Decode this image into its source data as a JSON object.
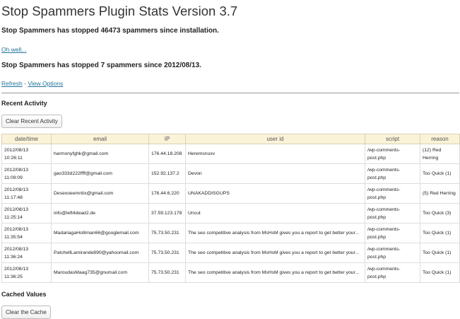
{
  "header": {
    "title": "Stop Spammers Plugin Stats Version 3.7"
  },
  "stats": {
    "total_line": "Stop Spammers has stopped 46473 spammers since installation.",
    "ohwell_label": "Oh well...",
    "since_line": "Stop Spammers has stopped 7 spammers since 2012/08/13."
  },
  "links": {
    "refresh_label": "Refresh",
    "separator": " - ",
    "options_label": "View Options"
  },
  "recent": {
    "heading": "Recent Activity",
    "clear_button": "Clear Recent Activity",
    "columns": [
      "date/time",
      "email",
      "IP",
      "user id",
      "script",
      "reason"
    ],
    "rows": [
      {
        "date": "2012/08/13",
        "time": "10:26:11",
        "email": "harmonyfghk@gmail.com",
        "ip": "176.44.18.208",
        "user": "Heremsnuxv",
        "script": "/wp-comments-post.php",
        "reason": "(12) Red Herring"
      },
      {
        "date": "2012/08/13",
        "time": "11:09:09",
        "email": "gao333d222ffff@gmail.com",
        "ip": "152.92.137.2",
        "user": "Devon",
        "script": "/wp-comments-post.php",
        "reason": "Too Quick (1)"
      },
      {
        "date": "2012/08/13",
        "time": "11:17:48",
        "email": "Desexoeemnlix@gmail.com",
        "ip": "176.44.6.220",
        "user": "UNAKADDISGUPS",
        "script": "/wp-comments-post.php",
        "reason": "(5) Red Herring"
      },
      {
        "date": "2012/08/13",
        "time": "11:25:14",
        "email": "info@left4dead2.de",
        "ip": "37.59.123.178",
        "user": "Uncut",
        "script": "/wp-comments-post.php",
        "reason": "Too Quick (3)"
      },
      {
        "date": "2012/08/13",
        "time": "11:35:54",
        "email": "MadariagaHolliman66@googlemail.com",
        "ip": "75.73.50.231",
        "user": "The seo competitive analysis from MsHsM gives you a report to get better your...",
        "script": "/wp-comments-post.php",
        "reason": "Too Quick (1)"
      },
      {
        "date": "2012/08/13",
        "time": "11:36:24",
        "email": "PatchellLamirande890@yahoomail.com",
        "ip": "75.73.50.231",
        "user": "The seo competitive analysis from MsHsM gives you a report to get better your...",
        "script": "/wp-comments-post.php",
        "reason": "Too Quick (1)"
      },
      {
        "date": "2012/08/13",
        "time": "11:36:25",
        "email": "MaroudasMaag735@gnumail.com",
        "ip": "75.73.50.231",
        "user": "The seo competitive analysis from MsHsM gives you a report to get better your...",
        "script": "/wp-comments-post.php",
        "reason": "Too Quick (1)"
      }
    ]
  },
  "cached": {
    "heading": "Cached Values",
    "clear_button": "Clear the Cache"
  },
  "colors": {
    "link": "#21759b",
    "header_bg": "#fbf3d8"
  }
}
